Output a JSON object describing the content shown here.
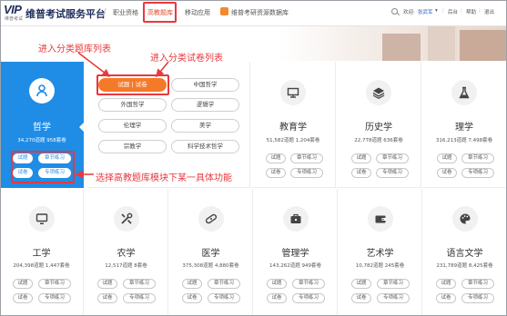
{
  "header": {
    "logo_text": "VIP",
    "logo_sub": "维普考试",
    "site_title": "维普考试服务平台",
    "nav": [
      {
        "label": "职业资格"
      },
      {
        "label": "高教题库"
      },
      {
        "label": "移动应用"
      },
      {
        "label": "维普考研资源数据库"
      }
    ],
    "active_nav": "高教题库",
    "welcome": "欢迎:",
    "user_name": "张武军",
    "user_links": [
      "后台",
      "帮助",
      "退出"
    ]
  },
  "subject_panel": {
    "items": [
      "试题 | 试卷",
      "中国哲学",
      "外国哲学",
      "逻辑学",
      "伦理学",
      "美学",
      "宗教学",
      "科学技术哲学"
    ],
    "active": "试题 | 试卷"
  },
  "cards": [
    {
      "name": "哲学",
      "stats": "34,270道题  958套卷",
      "icon": "person-circle-icon",
      "active": true,
      "buttons": [
        "试题",
        "章节练习",
        "试卷",
        "专项练习"
      ]
    },
    {
      "name": "教育学",
      "stats": "51,582道题  1,204套卷",
      "icon": "blackboard-icon",
      "active": false,
      "buttons": [
        "试题",
        "章节练习",
        "试卷",
        "专项练习"
      ]
    },
    {
      "name": "历史学",
      "stats": "22,778道题  636套卷",
      "icon": "layers-icon",
      "active": false,
      "buttons": [
        "试题",
        "章节练习",
        "试卷",
        "专项练习"
      ]
    },
    {
      "name": "理学",
      "stats": "316,213道题  7,498套卷",
      "icon": "flask-icon",
      "active": false,
      "buttons": [
        "试题",
        "章节练习",
        "试卷",
        "专项练习"
      ]
    },
    {
      "name": "工学",
      "stats": "204,398道题  1,447套卷",
      "icon": "computer-icon",
      "active": false,
      "buttons": [
        "试题",
        "章节练习",
        "试卷",
        "专项练习"
      ]
    },
    {
      "name": "农学",
      "stats": "12,517道题  8套卷",
      "icon": "tools-icon",
      "active": false,
      "buttons": [
        "试题",
        "章节练习",
        "试卷",
        "专项练习"
      ]
    },
    {
      "name": "医学",
      "stats": "375,308道题  4,880套卷",
      "icon": "bandage-icon",
      "active": false,
      "buttons": [
        "试题",
        "章节练习",
        "试卷",
        "专项练习"
      ]
    },
    {
      "name": "管理学",
      "stats": "143,262道题  949套卷",
      "icon": "briefcase-icon",
      "active": false,
      "buttons": [
        "试题",
        "章节练习",
        "试卷",
        "专项练习"
      ]
    },
    {
      "name": "艺术学",
      "stats": "10,782道题  245套卷",
      "icon": "wallet-icon",
      "active": false,
      "buttons": [
        "试题",
        "章节练习",
        "试卷",
        "专项练习"
      ]
    },
    {
      "name": "语言文学",
      "stats": "231,789道题  8,425套卷",
      "icon": "palette-icon",
      "active": false,
      "buttons": [
        "试题",
        "章节练习",
        "试卷",
        "专项练习"
      ]
    }
  ],
  "annotations": {
    "subject_list": "进入分类题库列表",
    "paper_list": "进入分类试卷列表",
    "function": "选择高教题库模块下某一具体功能"
  },
  "colors": {
    "active_card": "#1f8ce6",
    "active_subject": "#f47a2a",
    "annotation": "#e8383d"
  }
}
